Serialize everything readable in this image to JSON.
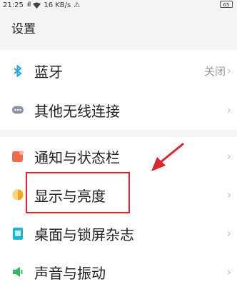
{
  "status_bar": {
    "time": "21:25",
    "signal": "ıll",
    "speed": "16 KB/s",
    "alert": "⚠",
    "battery": "65"
  },
  "page_title": "设置",
  "items": [
    {
      "label": "蓝牙",
      "value": "关闭",
      "icon": "bluetooth-icon",
      "color": "#1fa6e0"
    },
    {
      "label": "其他无线连接",
      "value": "",
      "icon": "more-dots-icon",
      "color": "#8a93a8"
    },
    {
      "label": "通知与状态栏",
      "value": "",
      "icon": "notification-icon",
      "color": "#f0694a"
    },
    {
      "label": "显示与亮度",
      "value": "",
      "icon": "display-brightness-icon",
      "color": "#f2a61a"
    },
    {
      "label": "桌面与锁屏杂志",
      "value": "",
      "icon": "desktop-lockscreen-icon",
      "color": "#17b6c9"
    },
    {
      "label": "声音与振动",
      "value": "",
      "icon": "speaker-icon",
      "color": "#2dbb5d"
    }
  ],
  "chevron": "›",
  "colors": {
    "highlight_border": "#d9272f",
    "arrow": "#d9272f"
  }
}
